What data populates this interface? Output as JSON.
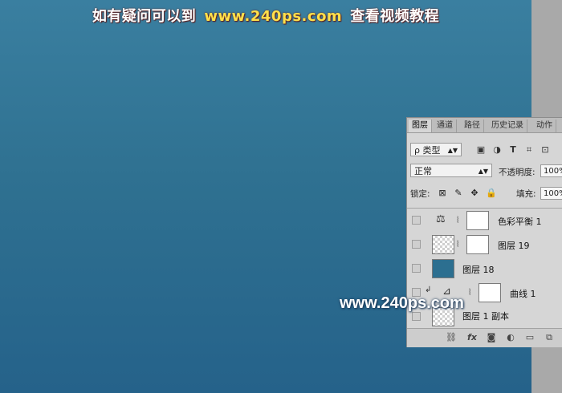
{
  "banner": {
    "part1": "如有疑问可以到",
    "part2": "www.240ps.com",
    "part3": "查看视频教程"
  },
  "watermark": "www.240ps.com",
  "colors": {
    "canvas_top": "#3a7fa0",
    "canvas_bottom": "#25628a",
    "banner_accent": "#ffe04a"
  },
  "panel": {
    "tabs": [
      "图层",
      "通道",
      "路径",
      "历史记录",
      "动作"
    ],
    "filter_select": "ρ 类型",
    "toolbar_icons": [
      "image-filter-icon",
      "adjustment-filter-icon",
      "type-filter-icon",
      "shape-filter-icon",
      "smartobject-filter-icon"
    ],
    "blend_mode": "正常",
    "opacity_label": "不透明度:",
    "opacity_value": "100%",
    "lock_label": "锁定:",
    "fill_label": "填充:",
    "fill_value": "100%",
    "layers": [
      {
        "name": "色彩平衡 1",
        "type": "adjustment",
        "icon": "color-balance-icon"
      },
      {
        "name": "图层 19",
        "type": "masked"
      },
      {
        "name": "图层 18",
        "type": "image"
      },
      {
        "name": "曲线 1",
        "type": "adjustment",
        "icon": "curves-icon"
      },
      {
        "name": "图层 1 副本",
        "type": "masked"
      }
    ]
  }
}
